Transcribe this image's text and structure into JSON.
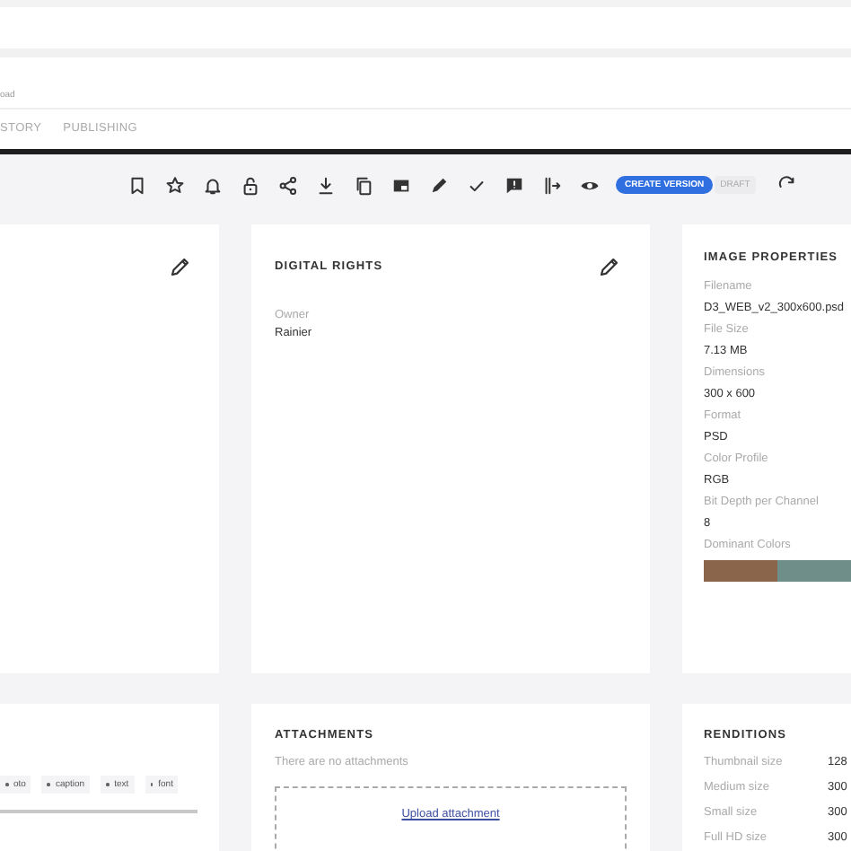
{
  "header": {
    "field_label": "oad",
    "tabs": [
      {
        "label": "STORY",
        "selected": false
      },
      {
        "label": "PUBLISHING",
        "selected": false
      }
    ]
  },
  "toolbar": {
    "create_version": "CREATE VERSION",
    "status_badge": "DRAFT"
  },
  "digital_rights": {
    "title": "DIGITAL RIGHTS",
    "fields": [
      {
        "label": "Owner",
        "value": "Rainier"
      }
    ]
  },
  "image_properties": {
    "title": "IMAGE PROPERTIES",
    "fields": [
      {
        "label": "Filename",
        "value": "D3_WEB_v2_300x600.psd"
      },
      {
        "label": "File Size",
        "value": "7.13 MB"
      },
      {
        "label": "Dimensions",
        "value": "300 x 600"
      },
      {
        "label": "Format",
        "value": "PSD"
      },
      {
        "label": "Color Profile",
        "value": "RGB"
      },
      {
        "label": "Bit Depth per Channel",
        "value": "8"
      }
    ],
    "dominant_colors": {
      "label": "Dominant Colors",
      "colors": [
        {
          "color": "#8b644c"
        },
        {
          "color": "#6f8d89"
        }
      ]
    }
  },
  "tags": [
    "oto",
    "caption",
    "text",
    "font"
  ],
  "attachments": {
    "title": "ATTACHMENTS",
    "empty_message": "There are no attachments",
    "upload_link": "Upload attachment"
  },
  "renditions": {
    "title": "RENDITIONS",
    "rows": [
      {
        "label": "Thumbnail size",
        "value": "128"
      },
      {
        "label": "Medium size",
        "value": "300"
      },
      {
        "label": "Small size",
        "value": "300"
      },
      {
        "label": "Full HD size",
        "value": "300"
      }
    ]
  }
}
